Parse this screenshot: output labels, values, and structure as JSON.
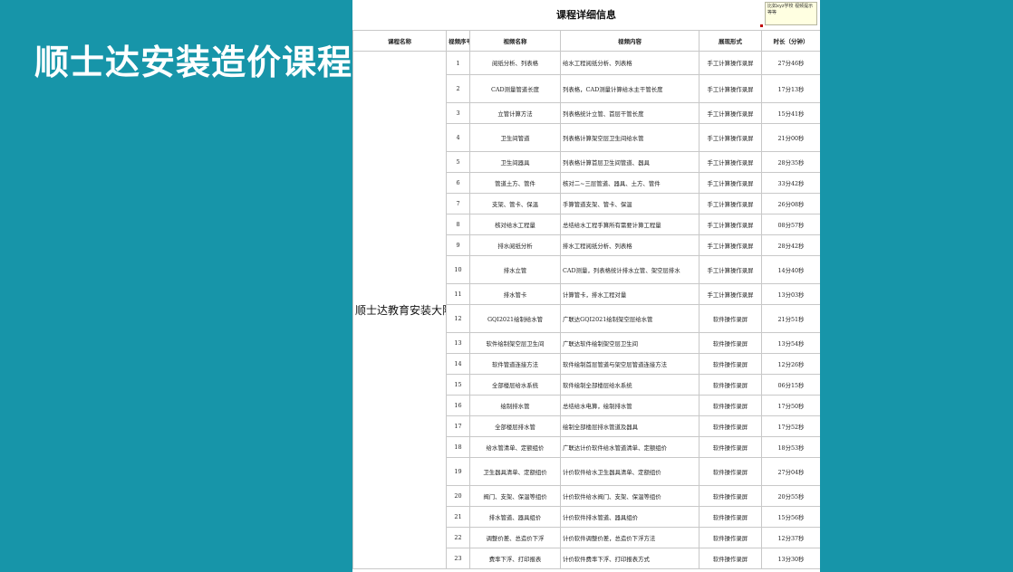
{
  "slide": {
    "title": "顺士达安装造价课程"
  },
  "sheet": {
    "title": "课程详细信息",
    "note": "比如xyz学校\n视频提示等等"
  },
  "table": {
    "headers": [
      "课程名称",
      "视频序号",
      "视频名称",
      "视频内容",
      "展现形式",
      "时长（分钟）"
    ],
    "course_name": "顺士达教育安装大隐南漳给排水",
    "rows": [
      {
        "no": "1",
        "name": "阅纸分析、列表格",
        "content": "给水工程阅纸分析、列表格",
        "form": "手工计算操作录屏",
        "duration": "27分46秒"
      },
      {
        "no": "2",
        "name": "CAD测量管道长度",
        "content": "列表格，CAD测量计算给水主干管长度",
        "form": "手工计算操作录屏",
        "duration": "17分13秒"
      },
      {
        "no": "3",
        "name": "立管计算方法",
        "content": "列表格统计立管、首层干管长度",
        "form": "手工计算操作录屏",
        "duration": "15分41秒"
      },
      {
        "no": "4",
        "name": "卫生间管道",
        "content": "列表格计算架空层卫生间给水管",
        "form": "手工计算操作录屏",
        "duration": "21分00秒"
      },
      {
        "no": "5",
        "name": "卫生间器具",
        "content": "列表格计算首层卫生间管道、器具",
        "form": "手工计算操作录屏",
        "duration": "28分35秒"
      },
      {
        "no": "6",
        "name": "管道土方、管件",
        "content": "核对二~三层管道、器具、土方、管件",
        "form": "手工计算操作录屏",
        "duration": "33分42秒"
      },
      {
        "no": "7",
        "name": "支架、管卡、保温",
        "content": "手算管道支架、管卡、保温",
        "form": "手工计算操作录屏",
        "duration": "26分08秒"
      },
      {
        "no": "8",
        "name": "核对给水工程量",
        "content": "总结给水工程手算所有需要计算工程量",
        "form": "手工计算操作录屏",
        "duration": "08分57秒"
      },
      {
        "no": "9",
        "name": "排水阅纸分析",
        "content": "排水工程阅纸分析、列表格",
        "form": "手工计算操作录屏",
        "duration": "28分42秒"
      },
      {
        "no": "10",
        "name": "排水立管",
        "content": "CAD测量，列表格统计排水立管、架空层排水",
        "form": "手工计算操作录屏",
        "duration": "14分40秒"
      },
      {
        "no": "11",
        "name": "排水管卡",
        "content": "计算管卡，排水工程对量",
        "form": "手工计算操作录屏",
        "duration": "13分03秒"
      },
      {
        "no": "12",
        "name": "GQI2021绘制给水管",
        "content": "广联达GQI2021绘制架空层给水管",
        "form": "软件操作录屏",
        "duration": "21分51秒"
      },
      {
        "no": "13",
        "name": "软件绘制架空层卫生间",
        "content": "广联达软件绘制架空层卫生间",
        "form": "软件操作录屏",
        "duration": "13分54秒"
      },
      {
        "no": "14",
        "name": "软件管道连接方法",
        "content": "软件绘制首层管道与架空层管道连接方法",
        "form": "软件操作录屏",
        "duration": "12分26秒"
      },
      {
        "no": "15",
        "name": "全部楼层给水系统",
        "content": "软件绘制全部楼层给水系统",
        "form": "软件操作录屏",
        "duration": "06分15秒"
      },
      {
        "no": "16",
        "name": "绘制排水管",
        "content": "总结给水电算，绘制排水管",
        "form": "软件操作录屏",
        "duration": "17分50秒"
      },
      {
        "no": "17",
        "name": "全部楼层排水管",
        "content": "绘制全部楼层排水管道及器具",
        "form": "软件操作录屏",
        "duration": "17分52秒"
      },
      {
        "no": "18",
        "name": "给水管清单、定额组价",
        "content": "广联达计价软件给水管道清单、定额组价",
        "form": "软件操作录屏",
        "duration": "18分53秒"
      },
      {
        "no": "19",
        "name": "卫生器具清单、定额组价",
        "content": "计价软件给水卫生器具清单、定额组价",
        "form": "软件操作录屏",
        "duration": "27分04秒"
      },
      {
        "no": "20",
        "name": "阀门、支架、保温等组价",
        "content": "计价软件给水阀门、支架、保温等组价",
        "form": "软件操作录屏",
        "duration": "20分55秒"
      },
      {
        "no": "21",
        "name": "排水管道、器具组价",
        "content": "计价软件排水管道、器具组价",
        "form": "软件操作录屏",
        "duration": "15分56秒"
      },
      {
        "no": "22",
        "name": "调整价差、总造价下浮",
        "content": "计价软件调整价差，总造价下浮方法",
        "form": "软件操作录屏",
        "duration": "12分37秒"
      },
      {
        "no": "23",
        "name": "费率下浮、打印报表",
        "content": "计价软件费率下浮、打印报表方式",
        "form": "软件操作录屏",
        "duration": "13分30秒"
      }
    ]
  }
}
